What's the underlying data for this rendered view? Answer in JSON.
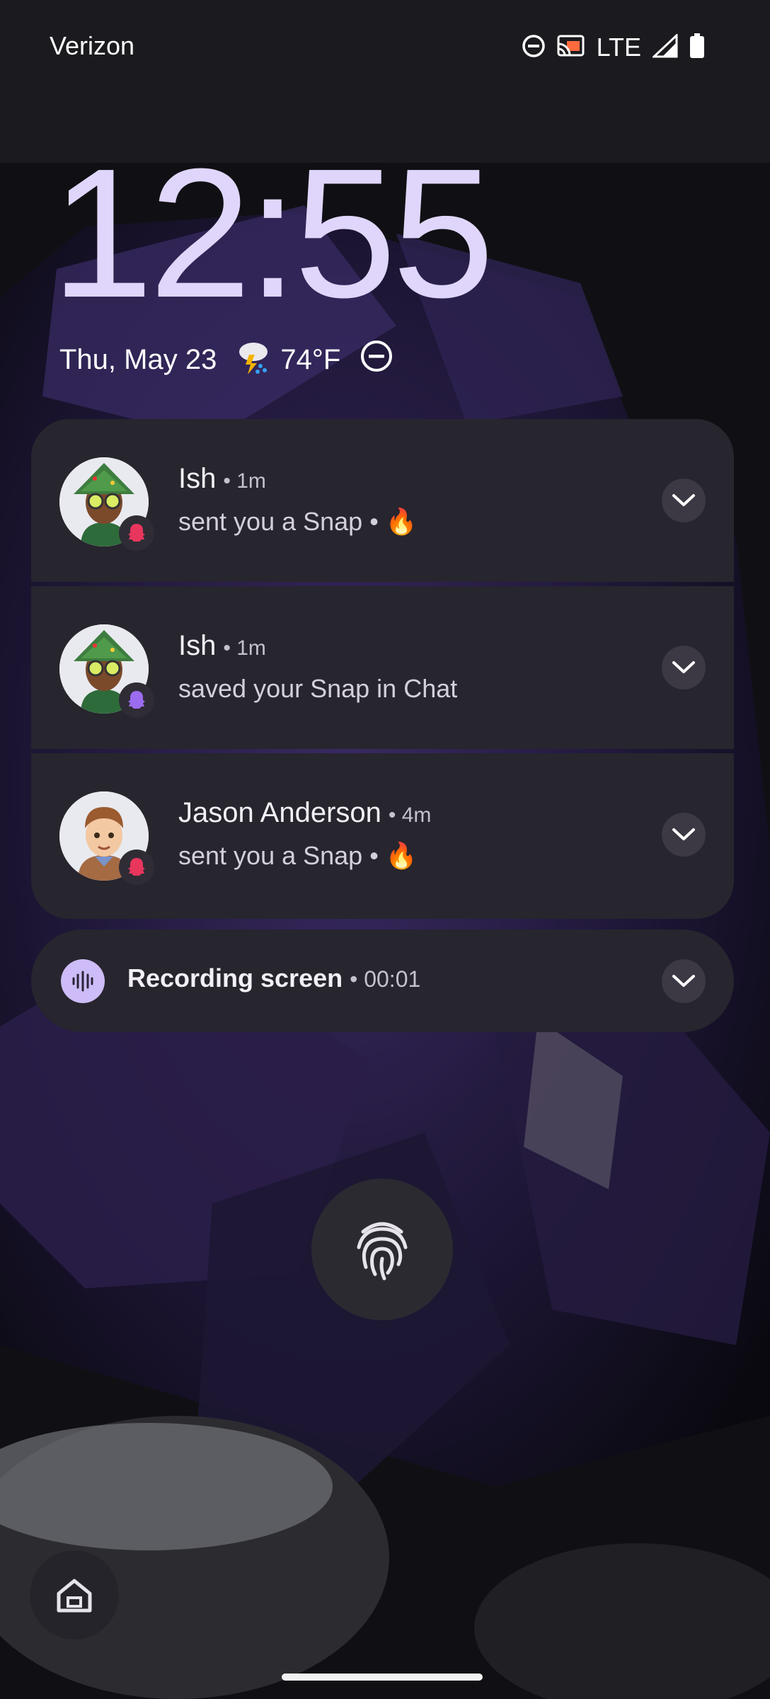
{
  "status_bar": {
    "carrier": "Verizon",
    "network": "LTE",
    "icons": [
      "do-not-disturb-icon",
      "cast-icon",
      "signal-icon",
      "battery-icon"
    ]
  },
  "lock_screen": {
    "time": "12:55",
    "date": "Thu, May 23",
    "temperature": "74°F",
    "weather_icon": "thunderstorm-icon",
    "dnd_icon": "do-not-disturb-icon"
  },
  "notifications": [
    {
      "sender": "Ish",
      "time": "• 1m",
      "message": "sent you a Snap •",
      "emoji": "🔥",
      "avatar": "bitmoji-ish",
      "badge": "snapchat-ghost-red"
    },
    {
      "sender": "Ish",
      "time": "• 1m",
      "message": "saved your Snap in Chat",
      "emoji": "",
      "avatar": "bitmoji-ish",
      "badge": "snapchat-ghost-purple"
    },
    {
      "sender": "Jason Anderson",
      "time": "• 4m",
      "message": "sent you a Snap •",
      "emoji": "🔥",
      "avatar": "bitmoji-jason",
      "badge": "snapchat-ghost-red"
    }
  ],
  "recording": {
    "label": "Recording screen",
    "time": "• 00:01"
  },
  "colors": {
    "accent": "#cdbcf7",
    "card": "#27252e",
    "clock": "#e0d6fb",
    "snap_red": "#e8365d"
  }
}
